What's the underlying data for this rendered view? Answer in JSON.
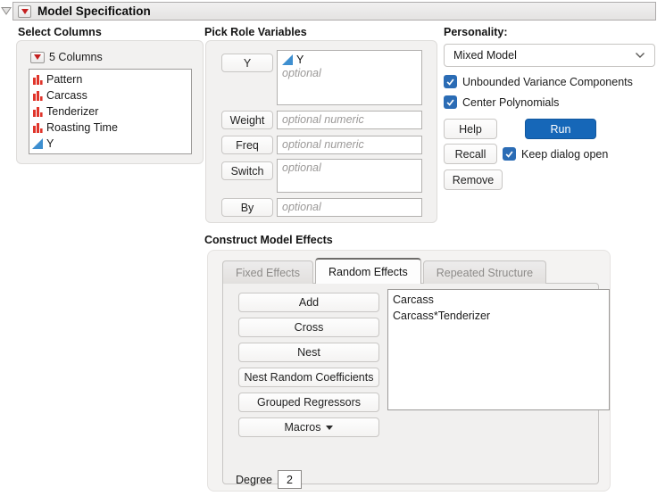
{
  "window": {
    "title": "Model Specification"
  },
  "select_columns": {
    "title": "Select Columns",
    "count_label": "5 Columns",
    "columns": [
      {
        "name": "Pattern",
        "icon": "nominal-bars-icon"
      },
      {
        "name": "Carcass",
        "icon": "nominal-bars-icon"
      },
      {
        "name": "Tenderizer",
        "icon": "nominal-bars-icon"
      },
      {
        "name": "Roasting Time",
        "icon": "nominal-bars-icon"
      },
      {
        "name": "Y",
        "icon": "continuous-triangle-icon"
      }
    ]
  },
  "pick_roles": {
    "title": "Pick Role Variables",
    "y": {
      "button": "Y",
      "assigned": [
        {
          "name": "Y",
          "icon": "continuous-triangle-icon"
        }
      ],
      "placeholder": "optional"
    },
    "weight": {
      "button": "Weight",
      "placeholder": "optional numeric"
    },
    "freq": {
      "button": "Freq",
      "placeholder": "optional numeric"
    },
    "switch": {
      "button": "Switch",
      "placeholder": "optional"
    },
    "by": {
      "button": "By",
      "placeholder": "optional"
    }
  },
  "personality": {
    "label": "Personality:",
    "selected": "Mixed Model",
    "checkboxes": [
      {
        "label": "Unbounded Variance Components",
        "checked": true
      },
      {
        "label": "Center Polynomials",
        "checked": true
      }
    ]
  },
  "actions": {
    "help": "Help",
    "run": "Run",
    "recall": "Recall",
    "remove": "Remove",
    "keep_dialog_open": {
      "label": "Keep dialog open",
      "checked": true
    }
  },
  "model_effects": {
    "title": "Construct Model Effects",
    "tabs": [
      {
        "label": "Fixed Effects",
        "active": false
      },
      {
        "label": "Random Effects",
        "active": true
      },
      {
        "label": "Repeated Structure",
        "active": false
      }
    ],
    "buttons": {
      "add": "Add",
      "cross": "Cross",
      "nest": "Nest",
      "nest_random_coefficients": "Nest Random Coefficients",
      "grouped_regressors": "Grouped Regressors",
      "macros": "Macros"
    },
    "degree": {
      "label": "Degree",
      "value": "2"
    },
    "effects": [
      "Carcass",
      "Carcass*Tenderizer"
    ]
  },
  "colors": {
    "run_button_blue": "#1667b8",
    "checkbox_blue": "#2b6cb5",
    "nominal_icon_red": "#e0352b",
    "continuous_icon_blue": "#3e8fd0",
    "menu_triangle_red": "#c42020"
  }
}
